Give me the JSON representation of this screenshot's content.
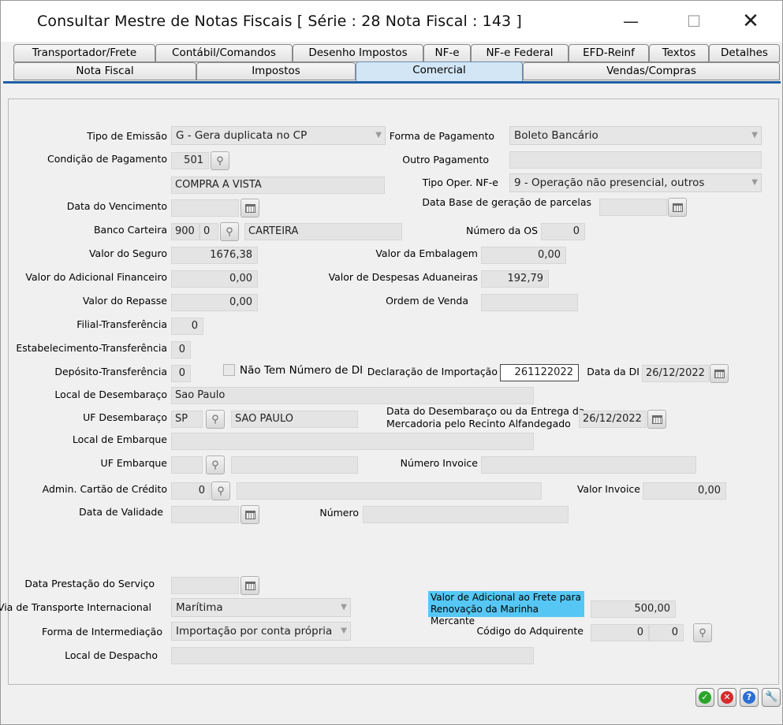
{
  "window": {
    "title": "Consultar Mestre de Notas Fiscais [ Série : 28  Nota Fiscal : 143 ]",
    "min": "—",
    "max": "☐",
    "close": "✕"
  },
  "tabs_row1": [
    "Transportador/Frete",
    "Contábil/Comandos",
    "Desenho Impostos",
    "NF-e",
    "NF-e Federal",
    "EFD-Reinf",
    "Textos",
    "Detalhes"
  ],
  "tabs_row2": [
    "Nota Fiscal",
    "Impostos",
    "Comercial",
    "Vendas/Compras"
  ],
  "active_tab": "Comercial",
  "form": {
    "tipo_emissao": {
      "label": "Tipo de Emissão",
      "value": "G - Gera duplicata no CP"
    },
    "forma_pagamento": {
      "label": "Forma de Pagamento",
      "value": "Boleto Bancário"
    },
    "condicao_pagamento": {
      "label": "Condição de Pagamento",
      "code": "501",
      "desc": "COMPRA A VISTA"
    },
    "outro_pagamento": {
      "label": "Outro Pagamento",
      "value": ""
    },
    "tipo_oper_nfe": {
      "label": "Tipo Oper. NF-e",
      "value": "9 - Operação não presencial, outros"
    },
    "data_vencimento": {
      "label": "Data do Vencimento",
      "value": ""
    },
    "data_base_parcelas": {
      "label": "Data Base de geração de parcelas",
      "value": ""
    },
    "banco_carteira": {
      "label": "Banco Carteira",
      "banco": "900",
      "carteira": "0",
      "desc": "CARTEIRA"
    },
    "numero_os": {
      "label": "Número da OS",
      "value": "0"
    },
    "valor_seguro": {
      "label": "Valor do Seguro",
      "value": "1676,38"
    },
    "valor_embalagem": {
      "label": "Valor da Embalagem",
      "value": "0,00"
    },
    "valor_adicional_financeiro": {
      "label": "Valor do Adicional Financeiro",
      "value": "0,00"
    },
    "valor_despesas_aduaneiras": {
      "label": "Valor de Despesas Aduaneiras",
      "value": "192,79"
    },
    "valor_repasse": {
      "label": "Valor do Repasse",
      "value": "0,00"
    },
    "ordem_venda": {
      "label": "Ordem de Venda",
      "value": ""
    },
    "filial_transferencia": {
      "label": "Filial-Transferência",
      "value": "0"
    },
    "estabelecimento_transferencia": {
      "label": "Estabelecimento-Transferência",
      "value": "0"
    },
    "deposito_transferencia": {
      "label": "Depósito-Transferência",
      "value": "0"
    },
    "nao_tem_numero_di": {
      "label": "Não Tem Número de DI",
      "checked": false
    },
    "declaracao_importacao": {
      "label": "Declaração de Importação",
      "value": "261122022"
    },
    "data_di": {
      "label": "Data da DI",
      "value": "26/12/2022"
    },
    "local_desembaraco": {
      "label": "Local de Desembaraço",
      "value": "Sao Paulo"
    },
    "uf_desembaraco": {
      "label": "UF Desembaraço",
      "uf": "SP",
      "desc": "SAO PAULO"
    },
    "data_desembaraco": {
      "label1": "Data do Desembaraço ou da Entrega da",
      "label2": "Mercadoria pelo Recinto Alfandegado",
      "value": "26/12/2022"
    },
    "local_embarque": {
      "label": "Local de Embarque",
      "value": ""
    },
    "uf_embarque": {
      "label": "UF Embarque",
      "uf": "",
      "desc": ""
    },
    "numero_invoice": {
      "label": "Número Invoice",
      "value": ""
    },
    "admin_cartao": {
      "label": "Admin. Cartão de Crédito",
      "code": "0",
      "desc": ""
    },
    "valor_invoice": {
      "label": "Valor Invoice",
      "value": "0,00"
    },
    "data_validade": {
      "label": "Data de Validade",
      "value": ""
    },
    "numero": {
      "label": "Número",
      "value": ""
    },
    "data_prestacao_servico": {
      "label": "Data Prestação do Serviço",
      "value": ""
    },
    "via_transporte": {
      "label": "Via de Transporte Internacional",
      "value": "Marítima"
    },
    "adicional_frete": {
      "label1": "Valor de Adicional ao Frete para",
      "label2": "Renovação da Marinha Mercante",
      "value": "500,00"
    },
    "forma_intermediacao": {
      "label": "Forma de Intermediação",
      "value": "Importação por conta própria"
    },
    "codigo_adquirente": {
      "label": "Código do Adquirente",
      "value1": "0",
      "value2": "0"
    },
    "local_despacho": {
      "label": "Local de Despacho",
      "value": ""
    }
  },
  "bottom_buttons": {
    "ok": "✓",
    "cancel": "✕",
    "help": "?",
    "tools": "🔧"
  },
  "icons": {
    "search": "⚲",
    "combo_arrow": "▼"
  },
  "colors": {
    "highlight": "#56c7f4",
    "tab_active": "#d3e6f6",
    "tab_underline": "#1e5fa6",
    "ok": "#2aa42a",
    "cancel": "#d42b2b",
    "help": "#2b6fd4",
    "tools": "#e08a1a"
  }
}
